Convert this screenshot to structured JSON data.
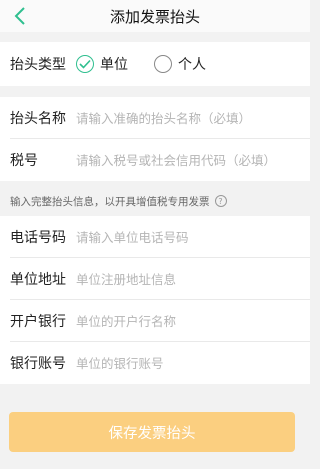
{
  "header": {
    "title": "添加发票抬头"
  },
  "type_row": {
    "label": "抬头类型",
    "options": [
      {
        "label": "单位",
        "selected": true
      },
      {
        "label": "个人",
        "selected": false
      }
    ]
  },
  "name_row": {
    "label": "抬头名称",
    "placeholder": "请输入准确的抬头名称（必填）"
  },
  "tax_row": {
    "label": "税号",
    "placeholder": "请输入税号或社会信用代码（必填）"
  },
  "hint": {
    "text": "输入完整抬头信息，以开具增值税专用发票"
  },
  "phone_row": {
    "label": "电话号码",
    "placeholder": "请输入单位电话号码"
  },
  "address_row": {
    "label": "单位地址",
    "placeholder": "单位注册地址信息"
  },
  "bank_row": {
    "label": "开户银行",
    "placeholder": "单位的开户行名称"
  },
  "account_row": {
    "label": "银行账号",
    "placeholder": "单位的银行账号"
  },
  "save_button": {
    "label": "保存发票抬头"
  },
  "colors": {
    "accent": "#2fbf8f",
    "save_button_bg": "#fbcf80",
    "background": "#f2f2f2"
  },
  "icons": {
    "back": "chevron-left-icon",
    "check": "check-icon",
    "help": "question-circle-icon"
  }
}
